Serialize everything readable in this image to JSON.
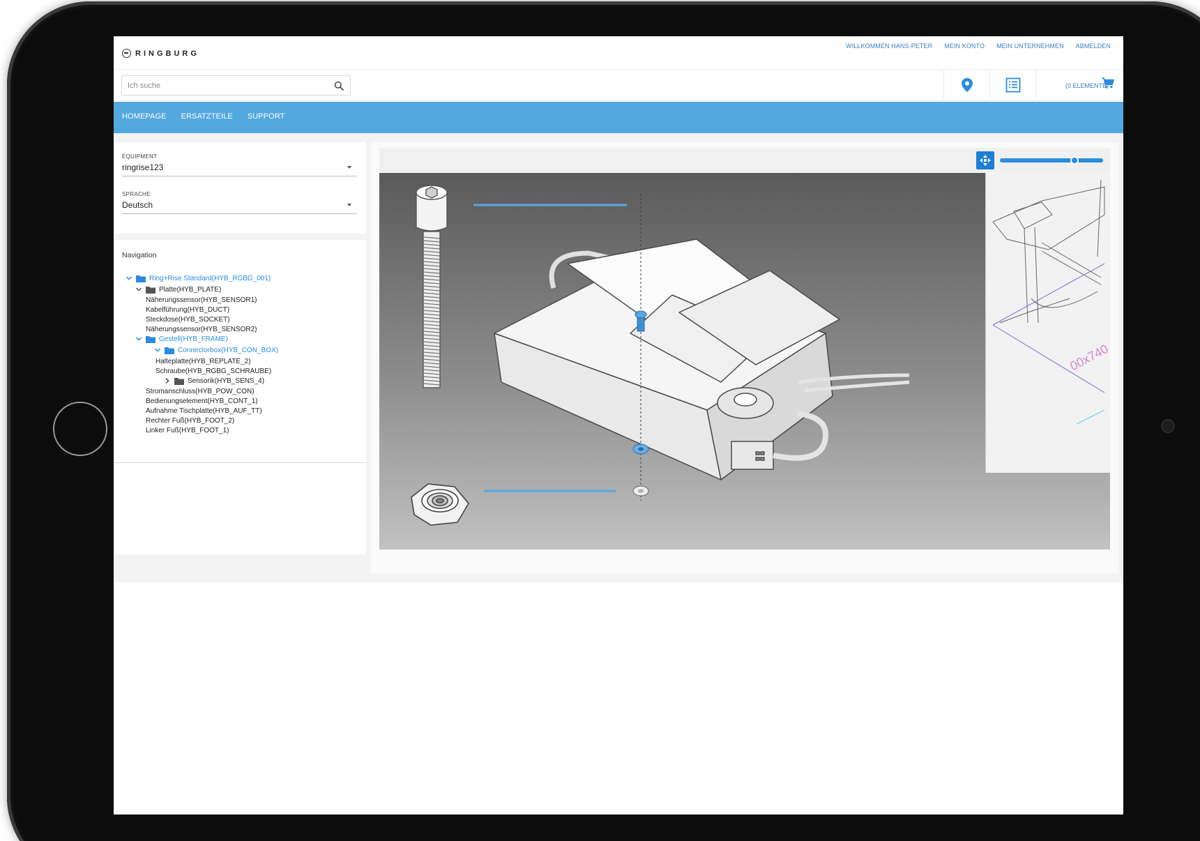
{
  "header": {
    "logo_text": "RINGBURG",
    "links": {
      "welcome": "WILLKOMMEN HANS-PETER",
      "account": "MEIN KONTO",
      "company": "MEIN UNTERNEHMEN",
      "logout": "ABMELDEN"
    },
    "search": {
      "placeholder": "Ich suche",
      "value": ""
    },
    "cart_label": "(0 ELEMENTE)"
  },
  "nav": {
    "items": [
      "HOMEPAGE",
      "ERSATZTEILE",
      "SUPPORT"
    ]
  },
  "filters": {
    "equipment": {
      "label": "EQUIPMENT",
      "value": "ringrise123"
    },
    "language": {
      "label": "SPRACHE",
      "value": "Deutsch"
    }
  },
  "navigation": {
    "title": "Navigation",
    "tree": [
      {
        "label": "Ring+Rise Standard(HYB_RGBG_001)",
        "level": 0,
        "type": "folder",
        "expanded": true,
        "selected": true
      },
      {
        "label": "Platte(HYB_PLATE)",
        "level": 1,
        "type": "folder",
        "expanded": true,
        "selected": false
      },
      {
        "label": "Näherungssensor(HYB_SENSOR1)",
        "level": 2,
        "type": "leaf"
      },
      {
        "label": "Kabelführung(HYB_DUCT)",
        "level": 2,
        "type": "leaf"
      },
      {
        "label": "Steckdose(HYB_SOCKET)",
        "level": 2,
        "type": "leaf"
      },
      {
        "label": "Näherungssensor(HYB_SENSOR2)",
        "level": 2,
        "type": "leaf"
      },
      {
        "label": "Gestell(HYB_FRAME)",
        "level": 1,
        "type": "folder",
        "expanded": true,
        "selected": true
      },
      {
        "label": "Connectorbox(HYB_CON_BOX)",
        "level": 2,
        "type": "folder",
        "expanded": true,
        "selected": true
      },
      {
        "label": "Halteplatte(HYB_REPLATE_2)",
        "level": 3,
        "type": "leaf"
      },
      {
        "label": "Schraube(HYB_RGBG_SCHRAUBE)",
        "level": 3,
        "type": "leaf"
      },
      {
        "label": "Sensorik(HYB_SENS_4)",
        "level": 3,
        "type": "folder",
        "expanded": false,
        "selected": false
      },
      {
        "label": "Stromanschluss(HYB_POW_CON)",
        "level": 2,
        "type": "leaf"
      },
      {
        "label": "Bedienungselement(HYB_CONT_1)",
        "level": 2,
        "type": "leaf"
      },
      {
        "label": "Aufnahme Tischplatte(HYB_AUF_TT)",
        "level": 2,
        "type": "leaf"
      },
      {
        "label": "Rechter Fuß(HYB_FOOT_2)",
        "level": 2,
        "type": "leaf"
      },
      {
        "label": "Linker Fuß(HYB_FOOT_1)",
        "level": 2,
        "type": "leaf"
      }
    ]
  },
  "viewer": {
    "zoom_level": 0.72,
    "minimap_text": "00x740"
  },
  "colors": {
    "accent": "#54a8e0",
    "link": "#3a7fc4",
    "tree_selected": "#2a8be0",
    "folder_gray": "#555555"
  }
}
